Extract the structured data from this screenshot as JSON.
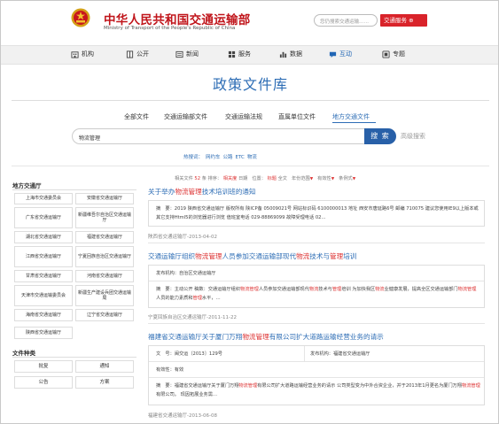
{
  "header": {
    "site_name_cn": "中华人民共和国交通运输部",
    "site_name_en": "Ministry of Transport of the People's Republic of China",
    "search_placeholder": "您仍搜索交通运输……",
    "service_button": "交通服务 ⊕",
    "colors": {
      "brand_red": "#c0151b",
      "service_red": "#d9232a"
    }
  },
  "nav": {
    "items": [
      {
        "label": "机构",
        "icon": "building-icon"
      },
      {
        "label": "公开",
        "icon": "open-door-icon"
      },
      {
        "label": "新闻",
        "icon": "newspaper-icon"
      },
      {
        "label": "服务",
        "icon": "grid-icon"
      },
      {
        "label": "数据",
        "icon": "bar-chart-icon"
      },
      {
        "label": "互动",
        "icon": "chat-icon"
      },
      {
        "label": "专题",
        "icon": "topic-icon"
      }
    ],
    "active": "互动"
  },
  "page_title": "政策文件库",
  "tabs": [
    "全部文件",
    "交通运输部文件",
    "交通运输法规",
    "直属单位文件",
    "地方交通文件"
  ],
  "active_tab": "地方交通文件",
  "search": {
    "value": "物流管理",
    "button": "搜 索",
    "advanced": "高级搜索"
  },
  "hot_words": {
    "label": "热搜词：",
    "items": [
      "网约车",
      "公路",
      "ETC",
      "物流"
    ]
  },
  "sidebar": {
    "local_heading": "地方交通厅",
    "local": [
      "上海市交通委员会",
      "安徽省交通运输厅",
      "广东省交通运输厅",
      "新疆维吾尔自治区交通运输厅",
      "湖北省交通运输厅",
      "福建省交通运输厅",
      "江西省交通运输厅",
      "宁夏回族自治区交通运输厅",
      "甘肃省交通运输厅",
      "河南省交通运输厅",
      "天津市交通运输委员会",
      "新疆生产建设兵团交通运输局",
      "海南省交通运输厅",
      "辽宁省交通运输厅",
      "陕西省交通运输厅"
    ],
    "type_heading": "文件种类",
    "types": [
      "批复",
      "通知",
      "公告",
      "方案"
    ]
  },
  "meta": {
    "prefix": "相关文件",
    "count": "52",
    "suffix": "条  排序：",
    "sort_rel": "相关度",
    "sort_date": "日期",
    "pos_label": "位置：",
    "pos_title": "标题",
    "pos_full": "全文",
    "year": "年份范围",
    "validity": "有效性",
    "doc_type": "条例式"
  },
  "results": [
    {
      "title_pre": "关于举办",
      "title_hl": "物流管理",
      "title_post": "技术培训班的通知",
      "summary_label": "摘　要：",
      "summary": "2019 陕西省交通运输厅 版权所有 陕ICP备 05009021号 网站标识码 6100000013 地址 西安市唐延路6号 邮编 710075 建议您使用IE9以上版本或其它支持Html5的浏览器进行浏览 值班室电话 029-88869099 故障受理电话 02…",
      "source": "陕西省交通运输厅-2013-04-02"
    },
    {
      "title_pre": "交通运输厅组织",
      "title_hl": "物流管理",
      "title_mid": "人员参加交通运输部现代",
      "title_hl2": "物流",
      "title_mid2": "技术与",
      "title_hl3": "管理",
      "title_post": "培训",
      "publisher_label": "发布机构：",
      "publisher": "自治区交通运输厅",
      "summary_label": "摘　要：",
      "summary_html_parts": [
        "主动公开 稿数：交通运输厅组织",
        "物流管理",
        "人员参加交通运输部现代",
        "物流",
        "技术与",
        "管理",
        "培训 为加快我区",
        "物流",
        "业健康发展，提高全区交通运输部门",
        "物流管理",
        "人员的能力素质和",
        "管理",
        "水平，…"
      ],
      "source": "宁夏回族自治区交通运输厅-2011-11-22"
    },
    {
      "title_pre": "福建省交通运输厅关于厦门万翔",
      "title_hl": "物流管理",
      "title_post": "有限公司扩大道路运输经营业务的请示",
      "doc_no_label": "文　号：",
      "doc_no": "闽交运〔2013〕129号",
      "publisher_label": "发布机构：",
      "publisher": "福建省交通运输厅",
      "validity_label": "有效性：",
      "validity": "有效",
      "summary_label": "摘　要：",
      "summary_parts": [
        "福建省交通运输厅关于厦门万翔",
        "物流管理",
        "有限公司扩大道路运输经营业务的请示 公司类型变为中外合资企业，并于2013年1月更名为厦门万翔",
        "物流管理",
        "有限公司。 现因拓展业务需…"
      ],
      "source": "福建省交通运输厅-2013-06-08"
    }
  ]
}
